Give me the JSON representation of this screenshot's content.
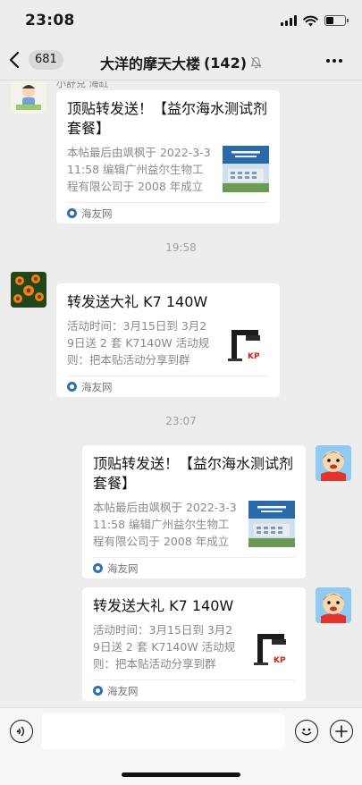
{
  "status": {
    "time": "23:08"
  },
  "nav": {
    "back_count": "681",
    "title": "大洋的摩天大楼",
    "member_count": "(142)"
  },
  "messages": [
    {
      "sender_name": "小舒兑 海缸",
      "card": {
        "title": "顶贴转发送！【益尔海水测试剂套餐】",
        "desc": "本帖最后由飒枫于 2022-3-311:58 编辑广州益尔生物工程有限公司于 2008 年成立",
        "source": "海友网",
        "thumb_icon": "building-photo-icon"
      }
    },
    {
      "card": {
        "title": "转发送大礼  K7 140W",
        "desc": "活动时间：3月15日到 3月29日送 2 套 K7140W 活动规则：把本贴活动分享到群",
        "source": "海友网",
        "thumb_icon": "lamp-photo-icon"
      }
    },
    {
      "card": {
        "title": "顶贴转发送！【益尔海水测试剂套餐】",
        "desc": "本帖最后由飒枫于 2022-3-311:58 编辑广州益尔生物工程有限公司于 2008 年成立",
        "source": "海友网",
        "thumb_icon": "building-photo-icon"
      }
    },
    {
      "card": {
        "title": "转发送大礼  K7 140W",
        "desc": "活动时间：3月15日到 3月29日送 2 套 K7140W 活动规则：把本贴活动分享到群",
        "source": "海友网",
        "thumb_icon": "lamp-photo-icon"
      }
    }
  ],
  "timestamps": [
    "19:58",
    "23:07"
  ],
  "input": {
    "placeholder": ""
  }
}
